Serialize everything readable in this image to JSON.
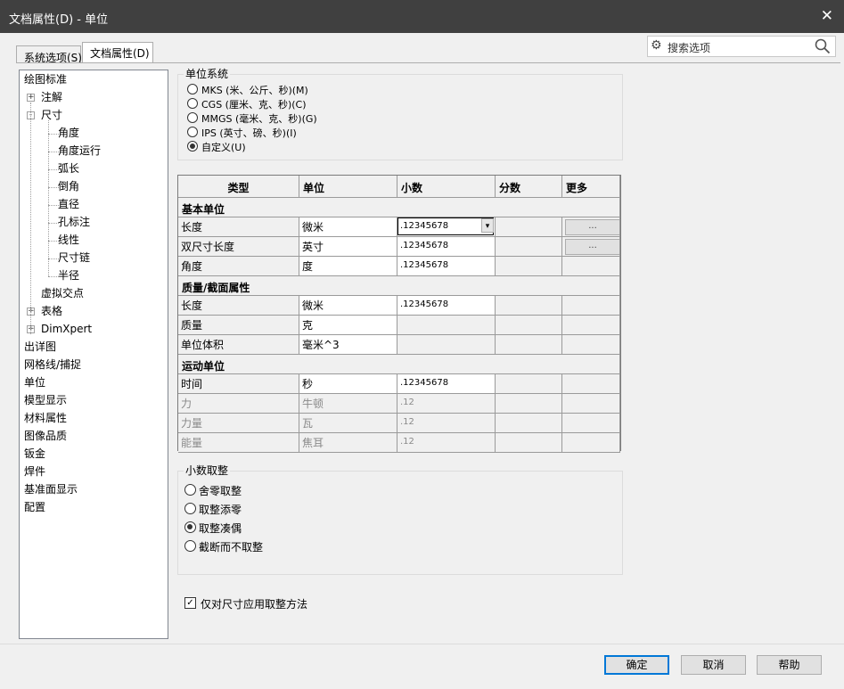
{
  "window": {
    "title": "文档属性(D) - 单位",
    "close_glyph": "✕"
  },
  "tabs": [
    {
      "label": "系统选项(S)",
      "active": false
    },
    {
      "label": "文档属性(D)",
      "active": true
    }
  ],
  "search": {
    "placeholder": "搜索选项"
  },
  "tree": {
    "items": [
      {
        "label": "绘图标准",
        "indent": 0
      },
      {
        "label": "注解",
        "indent": 1,
        "expander": "+"
      },
      {
        "label": "尺寸",
        "indent": 1,
        "expander": "-"
      },
      {
        "label": "角度",
        "indent": 2
      },
      {
        "label": "角度运行",
        "indent": 2
      },
      {
        "label": "弧长",
        "indent": 2
      },
      {
        "label": "倒角",
        "indent": 2
      },
      {
        "label": "直径",
        "indent": 2
      },
      {
        "label": "孔标注",
        "indent": 2
      },
      {
        "label": "线性",
        "indent": 2
      },
      {
        "label": "尺寸链",
        "indent": 2
      },
      {
        "label": "半径",
        "indent": 2
      },
      {
        "label": "虚拟交点",
        "indent": 1
      },
      {
        "label": "表格",
        "indent": 1,
        "expander": "+"
      },
      {
        "label": "DimXpert",
        "indent": 1,
        "expander": "+"
      },
      {
        "label": "出详图",
        "indent": 0
      },
      {
        "label": "网格线/捕捉",
        "indent": 0
      },
      {
        "label": "单位",
        "indent": 0
      },
      {
        "label": "模型显示",
        "indent": 0
      },
      {
        "label": "材料属性",
        "indent": 0
      },
      {
        "label": "图像品质",
        "indent": 0
      },
      {
        "label": "钣金",
        "indent": 0
      },
      {
        "label": "焊件",
        "indent": 0
      },
      {
        "label": "基准面显示",
        "indent": 0
      },
      {
        "label": "配置",
        "indent": 0
      }
    ]
  },
  "unit_system": {
    "legend": "单位系统",
    "options": [
      {
        "label": "MKS (米、公斤、秒)(M)",
        "selected": false
      },
      {
        "label": "CGS (厘米、克、秒)(C)",
        "selected": false
      },
      {
        "label": "MMGS (毫米、克、秒)(G)",
        "selected": false
      },
      {
        "label": "IPS (英寸、磅、秒)(I)",
        "selected": false
      },
      {
        "label": "自定义(U)",
        "selected": true
      }
    ]
  },
  "table": {
    "headers": [
      "类型",
      "单位",
      "小数",
      "分数",
      "更多"
    ],
    "sections": [
      {
        "title": "基本单位",
        "rows": [
          {
            "type": "长度",
            "unit": "微米",
            "decimal": ".12345678",
            "more": "...",
            "focused": true,
            "dim": false
          },
          {
            "type": "双尺寸长度",
            "unit": "英寸",
            "decimal": ".12345678",
            "more": "...",
            "dim": false
          },
          {
            "type": "角度",
            "unit": "度",
            "decimal": ".12345678",
            "dim": false
          }
        ]
      },
      {
        "title": "质量/截面属性",
        "rows": [
          {
            "type": "长度",
            "unit": "微米",
            "decimal": ".12345678",
            "dim": false
          },
          {
            "type": "质量",
            "unit": "克",
            "decimal": "",
            "dim": false
          },
          {
            "type": "单位体积",
            "unit": "毫米^3",
            "decimal": "",
            "dim": false
          }
        ]
      },
      {
        "title": "运动单位",
        "rows": [
          {
            "type": "时间",
            "unit": "秒",
            "decimal": ".12345678",
            "dim": false
          },
          {
            "type": "力",
            "unit": "牛顿",
            "decimal": ".12",
            "dim": true
          },
          {
            "type": "力量",
            "unit": "瓦",
            "decimal": ".12",
            "dim": true
          },
          {
            "type": "能量",
            "unit": "焦耳",
            "decimal": ".12",
            "dim": true
          }
        ]
      }
    ]
  },
  "rounding": {
    "legend": "小数取整",
    "options": [
      {
        "label": "舍零取整",
        "selected": false
      },
      {
        "label": "取整添零",
        "selected": false
      },
      {
        "label": "取整凑偶",
        "selected": true
      },
      {
        "label": "截断而不取整",
        "selected": false
      }
    ]
  },
  "apply_only_dims": {
    "label": "仅对尺寸应用取整方法",
    "checked": true
  },
  "buttons": {
    "ok": "确定",
    "cancel": "取消",
    "help": "帮助"
  }
}
